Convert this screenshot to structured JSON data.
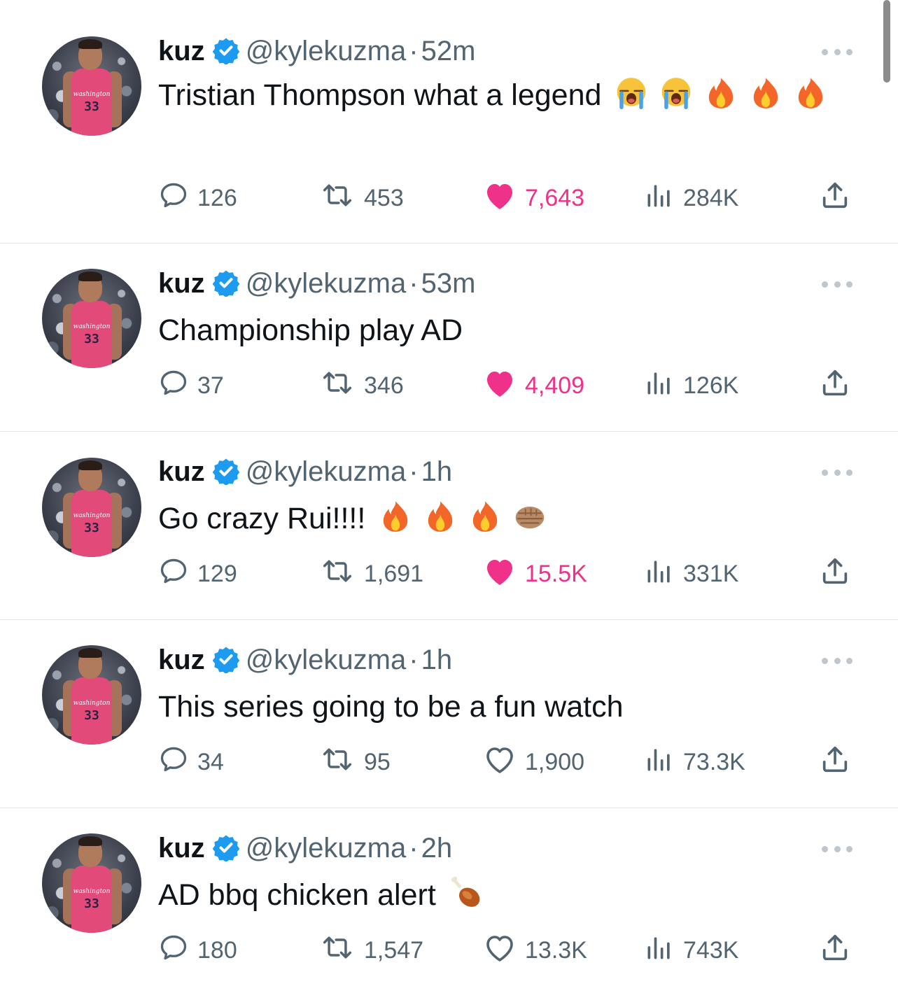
{
  "author": {
    "name": "kuz",
    "handle": "@kylekuzma",
    "separator": "·",
    "jersey_text": "washington",
    "jersey_number": "33"
  },
  "colors": {
    "like_active": "#f0318a",
    "verified": "#1d9bf0",
    "secondary_text": "#536471"
  },
  "tweets": [
    {
      "time": "52m",
      "text": "Tristian Thompson what a legend",
      "emojis": [
        "loudly-crying-face",
        "loudly-crying-face",
        "fire",
        "fire",
        "fire"
      ],
      "replies": "126",
      "reposts": "453",
      "likes": "7,643",
      "views": "284K",
      "liked": true
    },
    {
      "time": "53m",
      "text": "Championship play AD",
      "emojis": [],
      "replies": "37",
      "reposts": "346",
      "likes": "4,409",
      "views": "126K",
      "liked": true
    },
    {
      "time": "1h",
      "text": "Go crazy Rui!!!!",
      "emojis": [
        "fire",
        "fire",
        "fire",
        "oncoming-fist"
      ],
      "replies": "129",
      "reposts": "1,691",
      "likes": "15.5K",
      "views": "331K",
      "liked": true
    },
    {
      "time": "1h",
      "text": "This series going to be a fun watch",
      "emojis": [],
      "replies": "34",
      "reposts": "95",
      "likes": "1,900",
      "views": "73.3K",
      "liked": false
    },
    {
      "time": "2h",
      "text": "AD bbq chicken alert",
      "emojis": [
        "poultry-leg"
      ],
      "replies": "180",
      "reposts": "1,547",
      "likes": "13.3K",
      "views": "743K",
      "liked": false
    }
  ]
}
